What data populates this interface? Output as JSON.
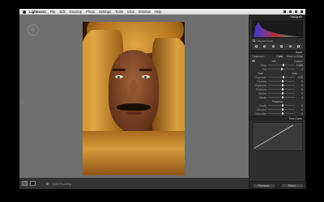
{
  "menubar": {
    "app_name": "Lightroom",
    "items": [
      "File",
      "Edit",
      "Develop",
      "Photo",
      "Settings",
      "Tools",
      "View",
      "Window",
      "Help"
    ]
  },
  "bottom_bar": {
    "soft_proofing": "Soft Proofing"
  },
  "panel": {
    "histogram_title": "Histogram",
    "original_photo": "Original Photo",
    "basic_title": "Basic",
    "treatment_label": "Treatment :",
    "treatment_color": "Color",
    "treatment_bw": "Black & White",
    "wb_label": "WB :",
    "wb_value": "Custom",
    "temp_label": "Temp",
    "temp_value": "5,550",
    "tint_label": "Tint",
    "tint_value": "-4",
    "tone_label": "Tone",
    "tone_auto": "Auto",
    "rows": [
      {
        "label": "Exposure",
        "value": "0.35",
        "pos": 0.55
      },
      {
        "label": "Contrast",
        "value": "0",
        "pos": 0.5
      },
      {
        "label": "Highlights",
        "value": "0",
        "pos": 0.5
      },
      {
        "label": "Shadows",
        "value": "0",
        "pos": 0.5
      },
      {
        "label": "Whites",
        "value": "0",
        "pos": 0.5
      },
      {
        "label": "Blacks",
        "value": "0",
        "pos": 0.5
      }
    ],
    "presence_label": "Presence",
    "presence_rows": [
      {
        "label": "Clarity",
        "value": "0",
        "pos": 0.5
      },
      {
        "label": "Vibrance",
        "value": "0",
        "pos": 0.5
      },
      {
        "label": "Saturation",
        "value": "0",
        "pos": 0.5
      }
    ],
    "tone_curve_title": "Tone Curve",
    "previous_button": "Previous",
    "reset_button": "Reset"
  }
}
